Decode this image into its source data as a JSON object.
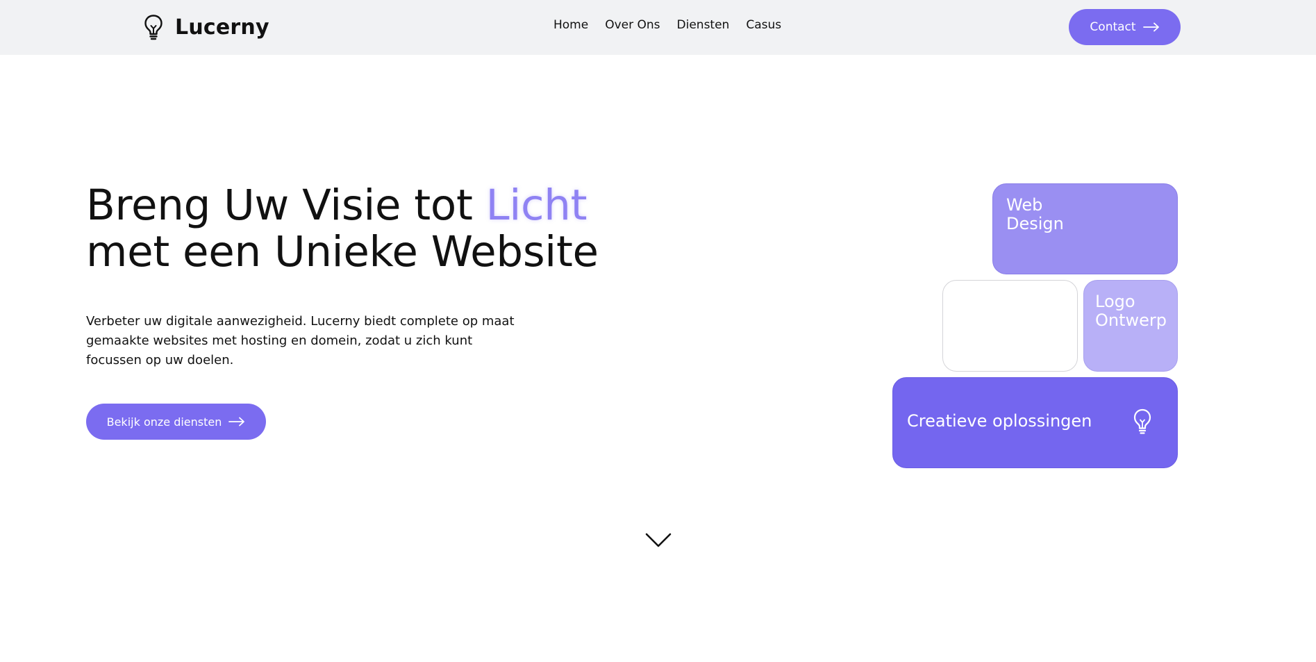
{
  "header": {
    "brand": "Lucerny",
    "logo_icon": "lightbulb-icon",
    "nav": [
      {
        "label": "Home"
      },
      {
        "label": "Over Ons"
      },
      {
        "label": "Diensten"
      },
      {
        "label": "Casus"
      }
    ],
    "contact_label": "Contact",
    "contact_icon": "arrow-right-icon"
  },
  "hero": {
    "title_part1": "Breng Uw Visie tot ",
    "title_accent": "Licht",
    "title_line2": "met een Unieke Website",
    "description": "Verbeter uw digitale aanwezigheid. Lucerny biedt complete op maat gemaakte websites met hosting en domein, zodat u zich kunt focussen op uw doelen.",
    "cta_label": "Bekijk onze diensten",
    "cta_icon": "arrow-right-icon"
  },
  "cards": {
    "web_line1": "Web",
    "web_line2": "Design",
    "logo_line1": "Logo",
    "logo_line2": "Ontwerp",
    "creative": "Creatieve oplossingen",
    "creative_icon": "lightbulb-icon"
  },
  "scroll_icon": "chevron-down-icon",
  "colors": {
    "accent": "#7b6cf0",
    "accent_text": "#8f82f3",
    "header_bg": "#f1f2f4",
    "card_web": "#9a8ff2",
    "card_logo": "#b8b0f7",
    "card_creative": "#7466ef"
  }
}
